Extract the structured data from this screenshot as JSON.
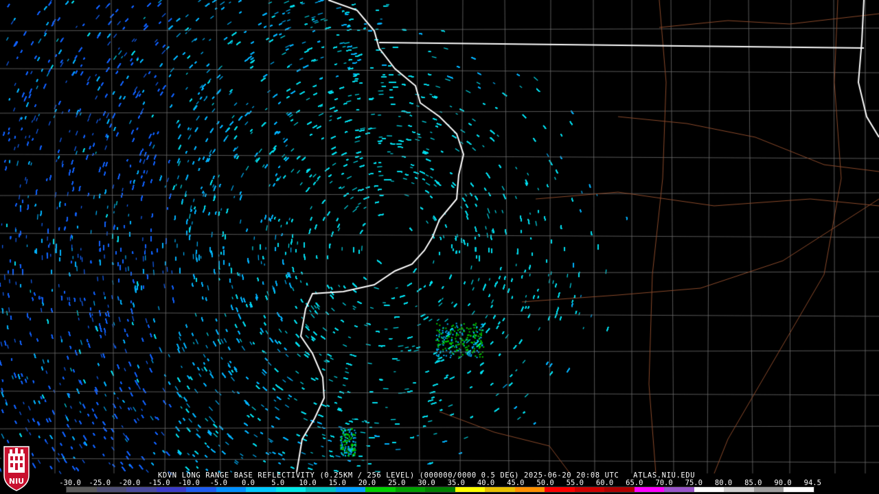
{
  "header": {
    "caption": "KDVN LONG RANGE BASE REFLECTIVITY (0.25KM / 256 LEVEL) (000000/0000 0.5 DEG) 2025-06-20 20:08 UTC   ATLAS.NIU.EDU"
  },
  "logo": {
    "text": "NIU",
    "colors": {
      "red": "#c8102e",
      "white": "#ffffff",
      "black": "#000000"
    }
  },
  "color_scale": {
    "labels": [
      "-30.0",
      "-25.0",
      "-20.0",
      "-15.0",
      "-10.0",
      "-5.0",
      "0.0",
      "5.0",
      "10.0",
      "15.0",
      "20.0",
      "25.0",
      "30.0",
      "35.0",
      "40.0",
      "45.0",
      "50.0",
      "55.0",
      "60.0",
      "65.0",
      "70.0",
      "75.0",
      "80.0",
      "85.0",
      "90.0",
      "94.5"
    ],
    "colors": [
      "#5a5a5a",
      "#4e4e74",
      "#4a4a9c",
      "#3c3cc8",
      "#1e5cf0",
      "#0090ff",
      "#00c8ff",
      "#00e8e8",
      "#00c0c0",
      "#00a0ff",
      "#00d000",
      "#00a000",
      "#008000",
      "#ffff00",
      "#e8c000",
      "#ff9000",
      "#ff0000",
      "#d00000",
      "#b00000",
      "#ff00ff",
      "#9955c9",
      "#ffffff",
      "#d0d0d0",
      "#a0a0a0",
      "#ffffff"
    ]
  },
  "map_colors": {
    "background": "#000000",
    "state_border": "#ffffff",
    "county_line": "#6e6e6e",
    "road": "#8b4a2b",
    "echo_light": "#00e0f0",
    "echo_mid": "#00b4ff",
    "echo_deep": "#1464ff",
    "echo_green": "#00d000"
  }
}
